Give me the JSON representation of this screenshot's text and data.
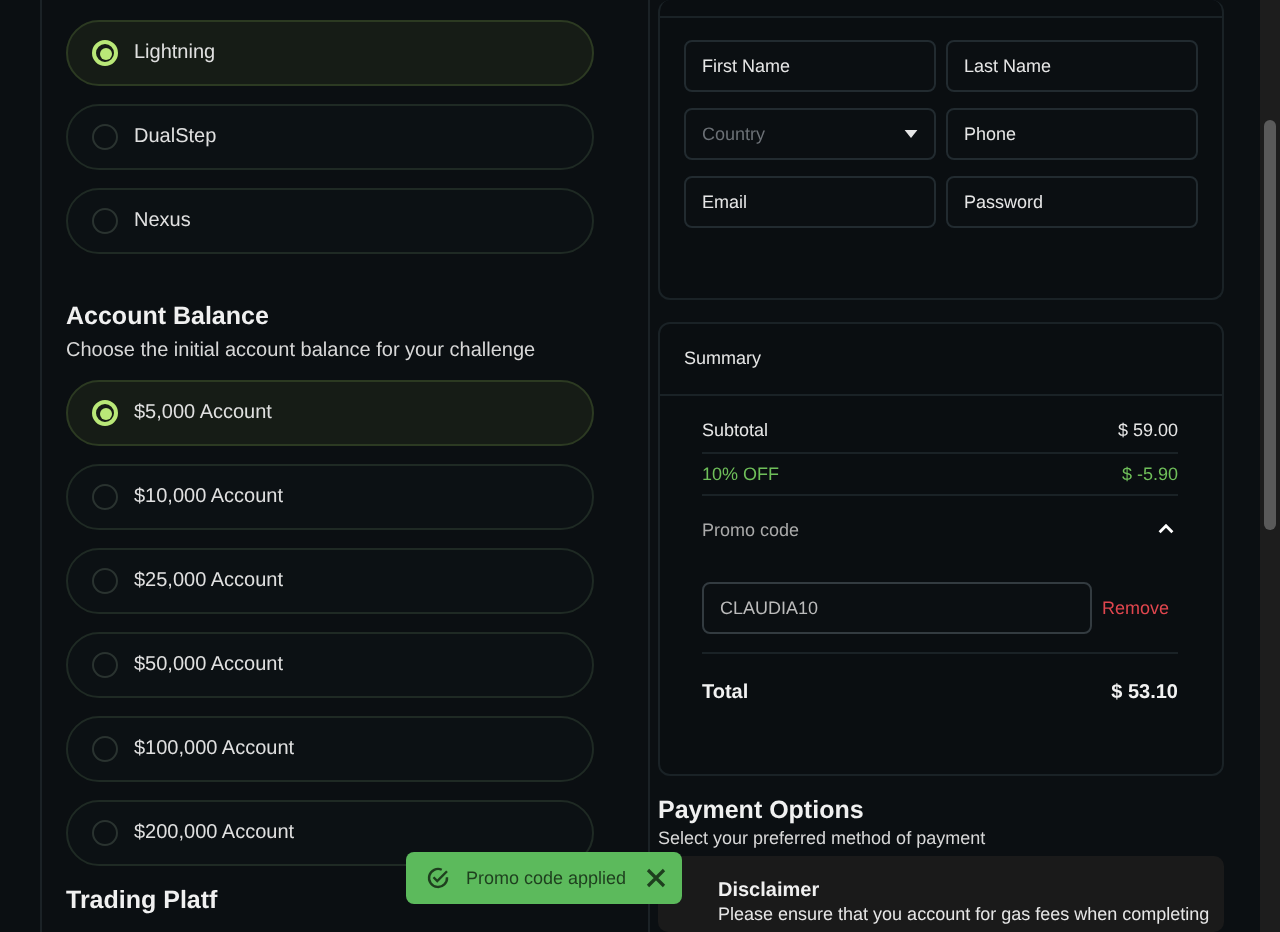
{
  "challenge_types": [
    {
      "label": "Lightning",
      "selected": true
    },
    {
      "label": "DualStep",
      "selected": false
    },
    {
      "label": "Nexus",
      "selected": false
    }
  ],
  "account_balance": {
    "title": "Account Balance",
    "subtitle": "Choose the initial account balance for your challenge",
    "options": [
      {
        "label": "$5,000 Account",
        "selected": true
      },
      {
        "label": "$10,000 Account",
        "selected": false
      },
      {
        "label": "$25,000 Account",
        "selected": false
      },
      {
        "label": "$50,000 Account",
        "selected": false
      },
      {
        "label": "$100,000 Account",
        "selected": false
      },
      {
        "label": "$200,000 Account",
        "selected": false
      }
    ]
  },
  "trading_platform": {
    "title": "Trading Platf"
  },
  "form": {
    "fields": [
      {
        "kind": "input",
        "placeholder": "First Name"
      },
      {
        "kind": "input",
        "placeholder": "Last Name"
      },
      {
        "kind": "select",
        "placeholder": "Country"
      },
      {
        "kind": "input",
        "placeholder": "Phone"
      },
      {
        "kind": "input",
        "placeholder": "Email"
      },
      {
        "kind": "input",
        "placeholder": "Password"
      }
    ]
  },
  "summary": {
    "title": "Summary",
    "rows": [
      {
        "kind": "line",
        "label": "Subtotal",
        "value": "$ 59.00"
      },
      {
        "kind": "discount",
        "label": "10% OFF",
        "value": "$ -5.90"
      }
    ],
    "promo": {
      "label": "Promo code",
      "expanded": true,
      "value": "CLAUDIA10",
      "action": "Remove"
    },
    "total": {
      "label": "Total",
      "value": "$ 53.10"
    }
  },
  "payment": {
    "title": "Payment Options",
    "subtitle": "Select your preferred method of payment",
    "disclaimer": {
      "title": "Disclaimer",
      "text": "Please ensure that you account for gas fees when completing"
    }
  },
  "toast": {
    "text": "Promo code applied"
  }
}
